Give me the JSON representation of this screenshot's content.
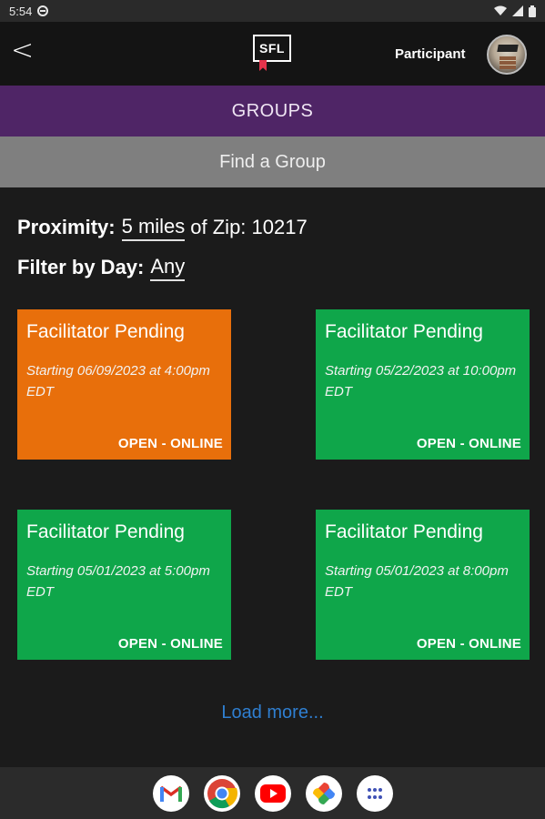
{
  "status_bar": {
    "time": "5:54"
  },
  "header": {
    "logo_text": "SFL",
    "role_label": "Participant"
  },
  "nav": {
    "groups_label": "GROUPS",
    "find_group_label": "Find a Group"
  },
  "filters": {
    "proximity_label": "Proximity:",
    "proximity_value": "5 miles",
    "zip_label": "of Zip: 10217",
    "day_label": "Filter by Day:",
    "day_value": "Any"
  },
  "cards": [
    {
      "title": "Facilitator Pending",
      "start": "Starting 06/09/2023 at 4:00pm EDT",
      "status": "OPEN - ONLINE",
      "color": "#e86f0b"
    },
    {
      "title": "Facilitator Pending",
      "start": "Starting 05/22/2023 at 10:00pm  EDT",
      "status": "OPEN - ONLINE",
      "color": "#0fa64a"
    },
    {
      "title": "Facilitator Pending",
      "start": "Starting 05/01/2023 at 5:00pm EDT",
      "status": "OPEN - ONLINE",
      "color": "#0fa64a"
    },
    {
      "title": "Facilitator Pending",
      "start": "Starting 05/01/2023 at 8:00pm EDT",
      "status": "OPEN - ONLINE",
      "color": "#0fa64a"
    }
  ],
  "load_more_label": "Load more...",
  "dock_apps": [
    "gmail-icon",
    "chrome-icon",
    "youtube-icon",
    "photos-icon",
    "app-drawer-icon"
  ]
}
